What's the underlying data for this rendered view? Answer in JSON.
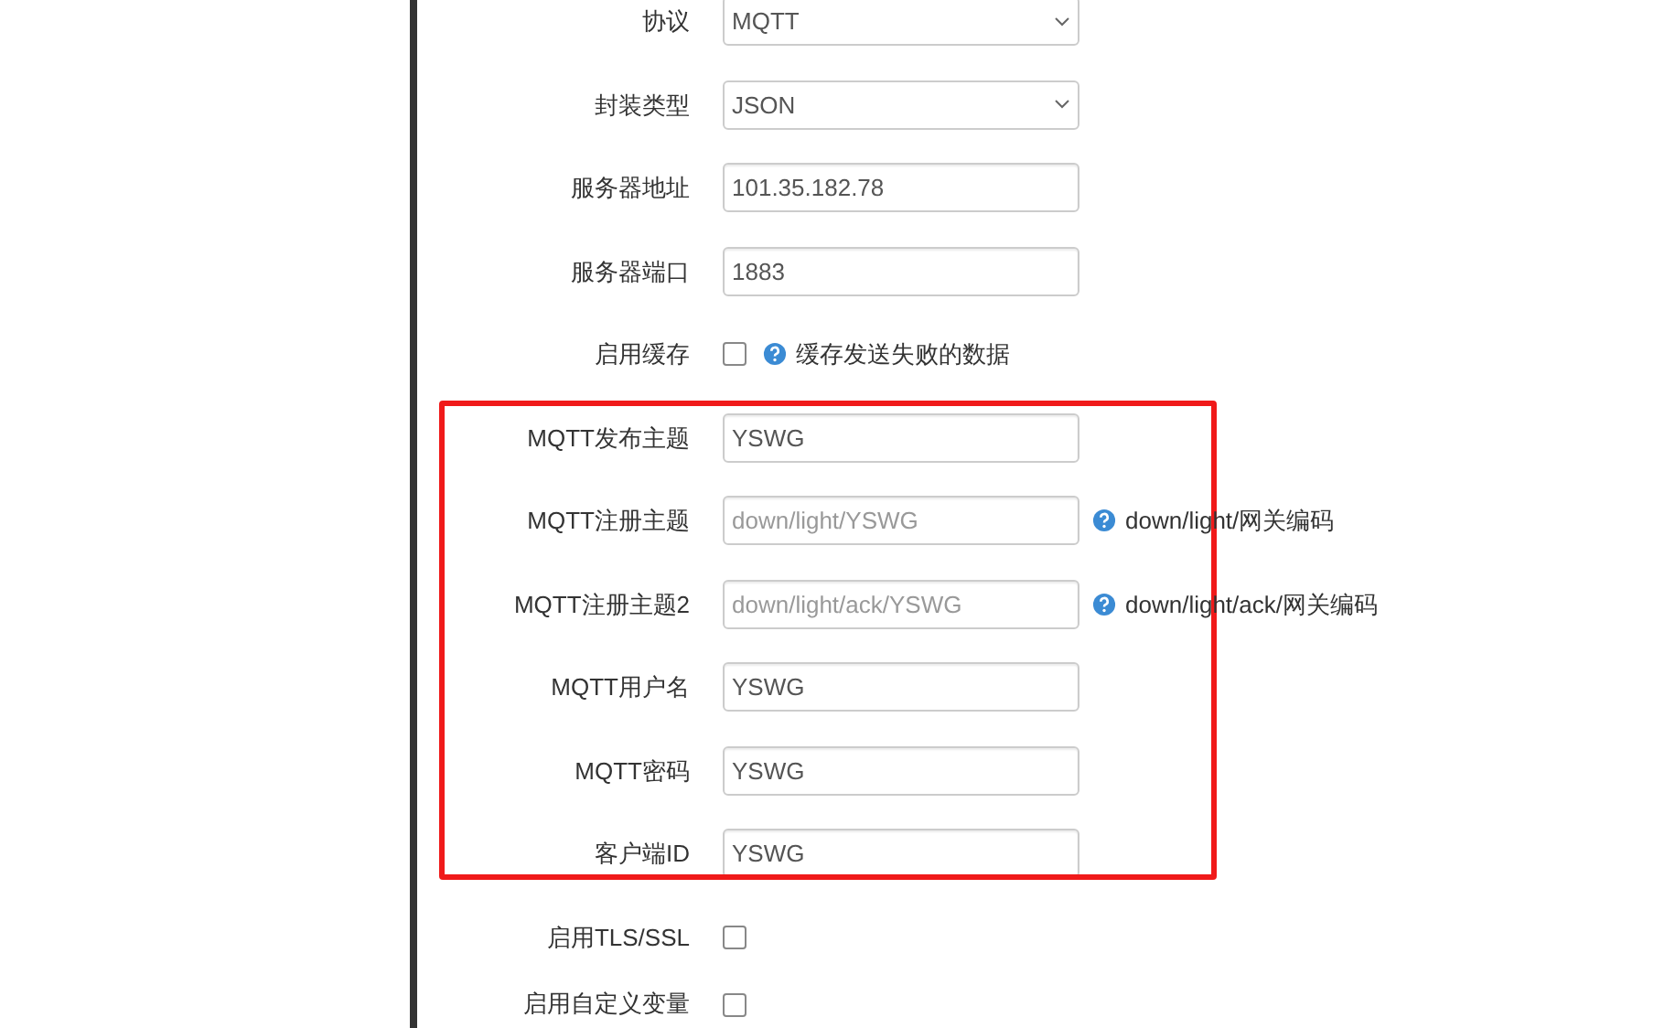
{
  "form": {
    "rows": [
      {
        "kind": "select",
        "label": "协议",
        "value": "MQTT"
      },
      {
        "kind": "select",
        "label": "封装类型",
        "value": "JSON"
      },
      {
        "kind": "text",
        "label": "服务器地址",
        "value": "101.35.182.78"
      },
      {
        "kind": "text",
        "label": "服务器端口",
        "value": "1883"
      },
      {
        "kind": "checkbox",
        "label": "启用缓存",
        "checked": false,
        "hint": "缓存发送失败的数据"
      },
      {
        "kind": "text",
        "label": "MQTT发布主题",
        "value": "YSWG"
      },
      {
        "kind": "text",
        "label": "MQTT注册主题",
        "placeholder": "down/light/YSWG",
        "hint": "down/light/网关编码"
      },
      {
        "kind": "text",
        "label": "MQTT注册主题2",
        "placeholder": "down/light/ack/YSWG",
        "hint": "down/light/ack/网关编码"
      },
      {
        "kind": "text",
        "label": "MQTT用户名",
        "value": "YSWG"
      },
      {
        "kind": "text",
        "label": "MQTT密码",
        "value": "YSWG"
      },
      {
        "kind": "text",
        "label": "客户端ID",
        "value": "YSWG"
      },
      {
        "kind": "checkbox",
        "label": "启用TLS/SSL",
        "checked": false
      },
      {
        "kind": "checkbox",
        "label": "启用自定义变量",
        "checked": false
      }
    ]
  }
}
